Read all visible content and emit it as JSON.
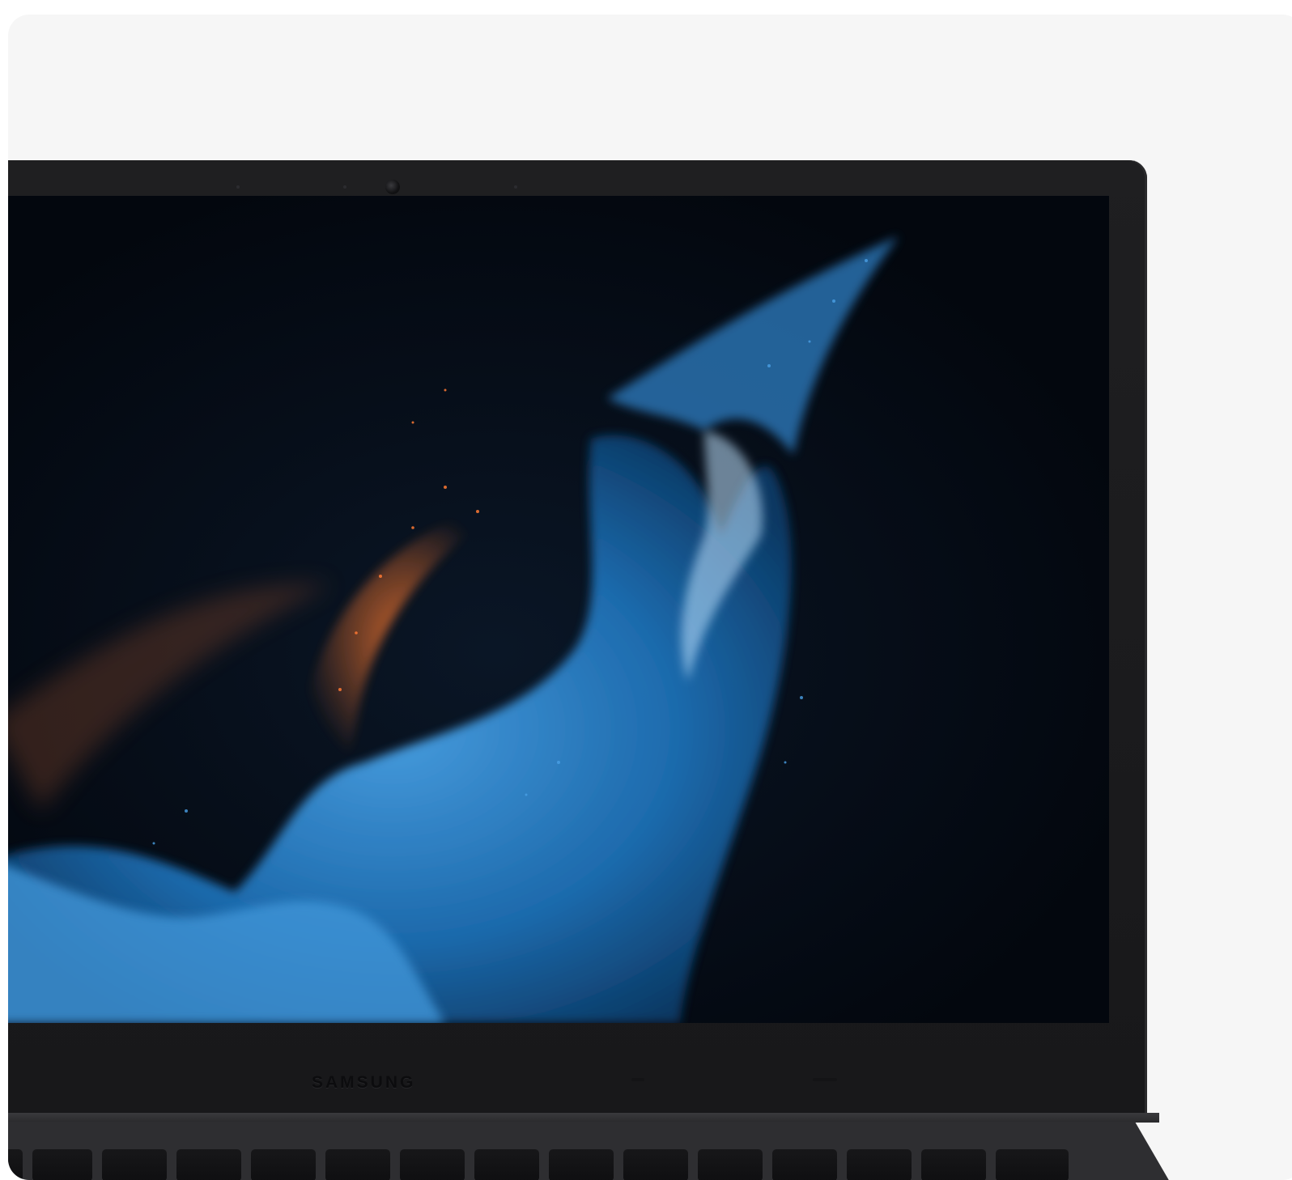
{
  "photo": {
    "subject": "laptop",
    "brand_text": "SAMSUNG"
  },
  "colors": {
    "background": "#f6f6f6",
    "bezel": "#1a1a1c",
    "screen": "#050a13",
    "particle_blue": "#3f8fd6",
    "particle_orange": "#e0642a"
  },
  "icons": [
    "webcam-icon"
  ]
}
